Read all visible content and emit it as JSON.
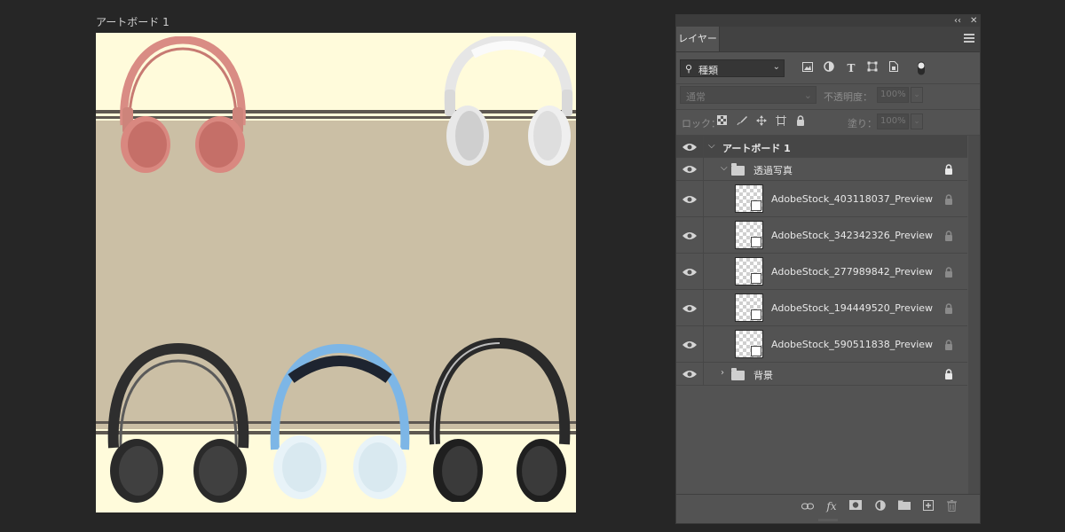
{
  "artboard": {
    "title": "アートボード 1"
  },
  "panel": {
    "collapse_label": "‹‹",
    "close_label": "✕",
    "tab_label": "レイヤー",
    "filter": {
      "search_icon": "⚲",
      "value": "種類",
      "caret": "⌄"
    },
    "filter_icons": [
      "image-filter-icon",
      "adjustment-filter-icon",
      "type-filter-icon",
      "shape-filter-icon",
      "smartobject-filter-icon",
      "filter-toggle-icon"
    ],
    "blend_mode": "通常",
    "opacity_label": "不透明度：",
    "opacity_value": "100%",
    "lock_label": "ロック：",
    "fill_label": "塗り：",
    "fill_value": "100%",
    "layers": [
      {
        "name": "アートボード 1",
        "type": "artboard",
        "locked": false
      },
      {
        "name": "透過写真",
        "type": "group",
        "locked": true
      },
      {
        "name": "AdobeStock_403118037_Preview",
        "type": "smart",
        "locked": true
      },
      {
        "name": "AdobeStock_342342326_Preview",
        "type": "smart",
        "locked": true
      },
      {
        "name": "AdobeStock_277989842_Preview",
        "type": "smart",
        "locked": true
      },
      {
        "name": "AdobeStock_194449520_Preview",
        "type": "smart",
        "locked": true
      },
      {
        "name": "AdobeStock_590511838_Preview",
        "type": "smart",
        "locked": true
      },
      {
        "name": "背景",
        "type": "group",
        "locked": true
      }
    ],
    "bottom_icons": [
      "link-layers-icon",
      "fx-icon",
      "mask-icon",
      "adjustment-layer-icon",
      "new-group-icon",
      "new-layer-icon",
      "delete-icon"
    ],
    "fx_label": "fx"
  },
  "colors": {
    "artboard_bg": "#fffbdb",
    "tan_band": "#cbbfa5",
    "panel_bg": "#535353",
    "app_bg": "#262626"
  }
}
